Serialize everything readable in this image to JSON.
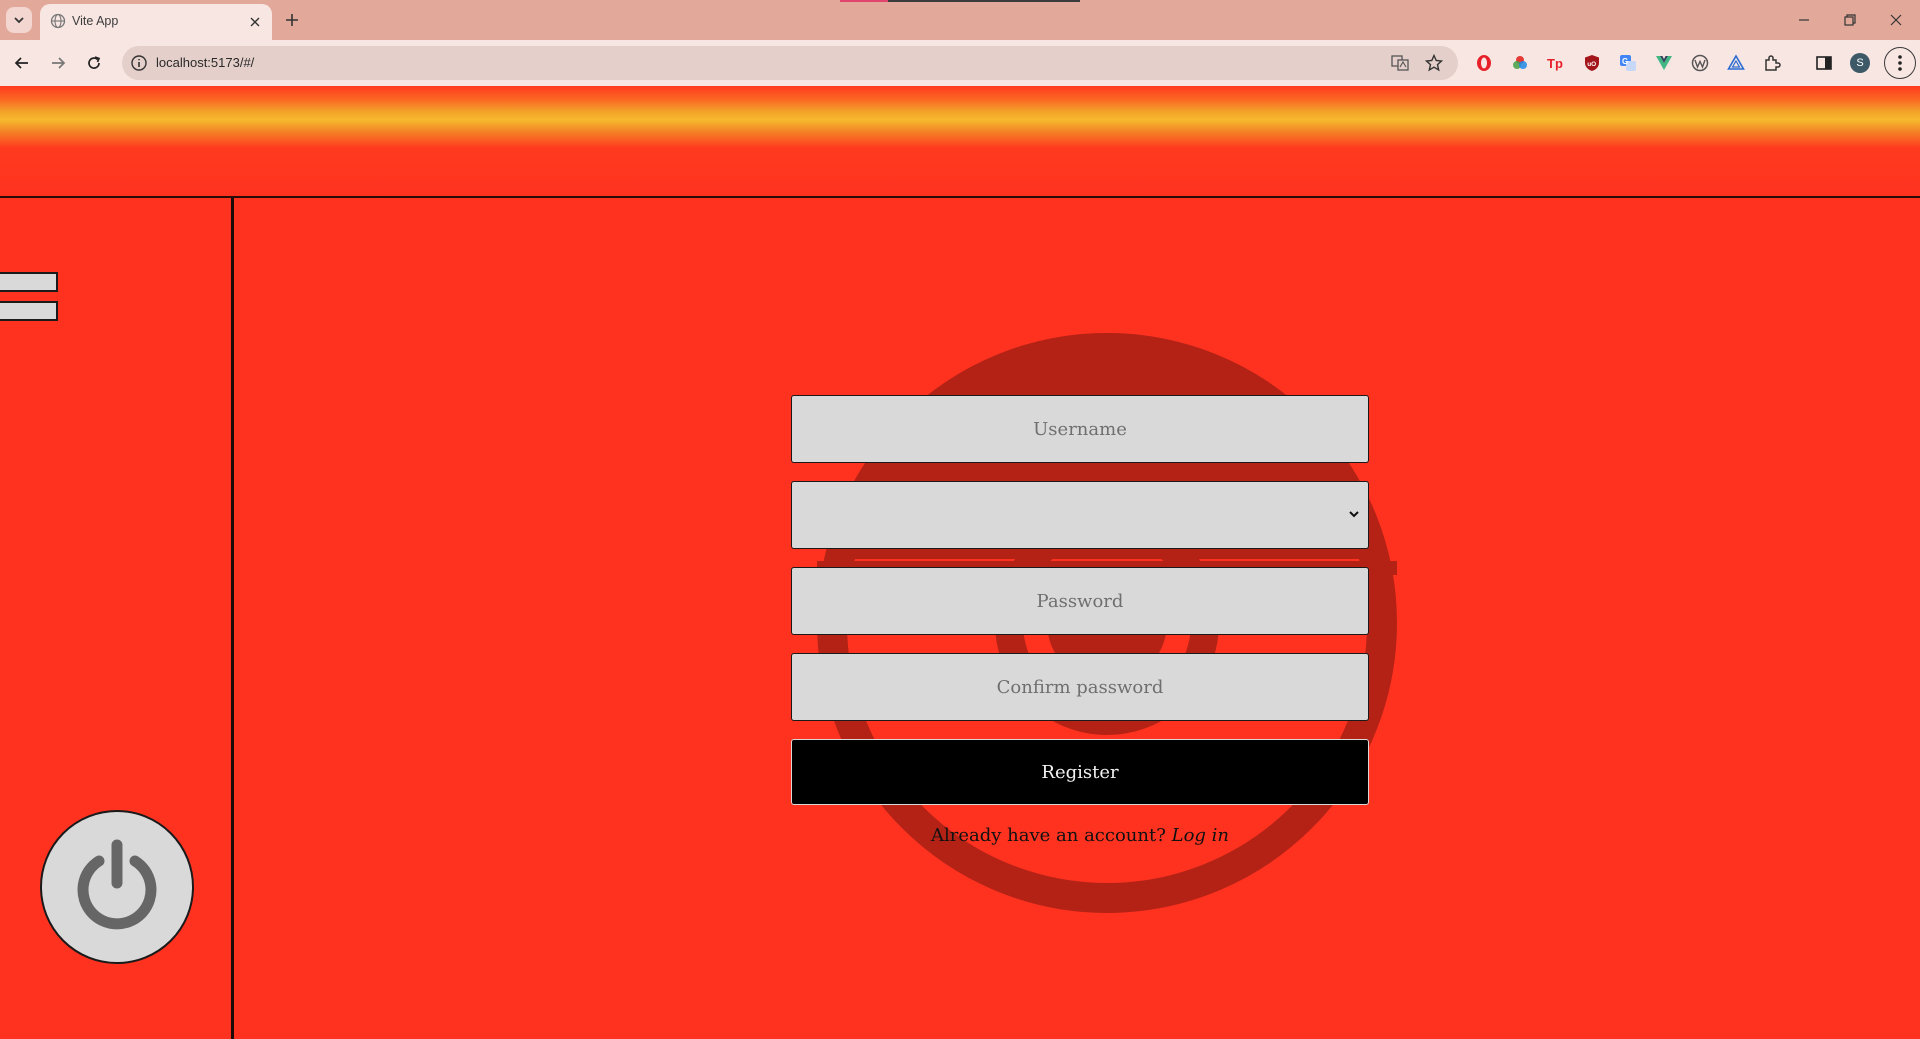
{
  "browser": {
    "tab_title": "Vite App",
    "url": "localhost:5173/#/",
    "profile_initial": "S"
  },
  "form": {
    "username_placeholder": "Username",
    "role_selected": "",
    "password_placeholder": "Password",
    "confirm_password_placeholder": "Confirm password",
    "register_label": "Register",
    "login_prompt": "Already have an account?",
    "login_link": "Log in"
  },
  "theme": {
    "background": "#ff3220",
    "input_bg": "#d9d9d9",
    "button_bg": "#000000",
    "pokeball_ring": "#b42216"
  },
  "icons": {
    "sidebar_menu": "hamburger-icon",
    "power": "power-icon"
  }
}
